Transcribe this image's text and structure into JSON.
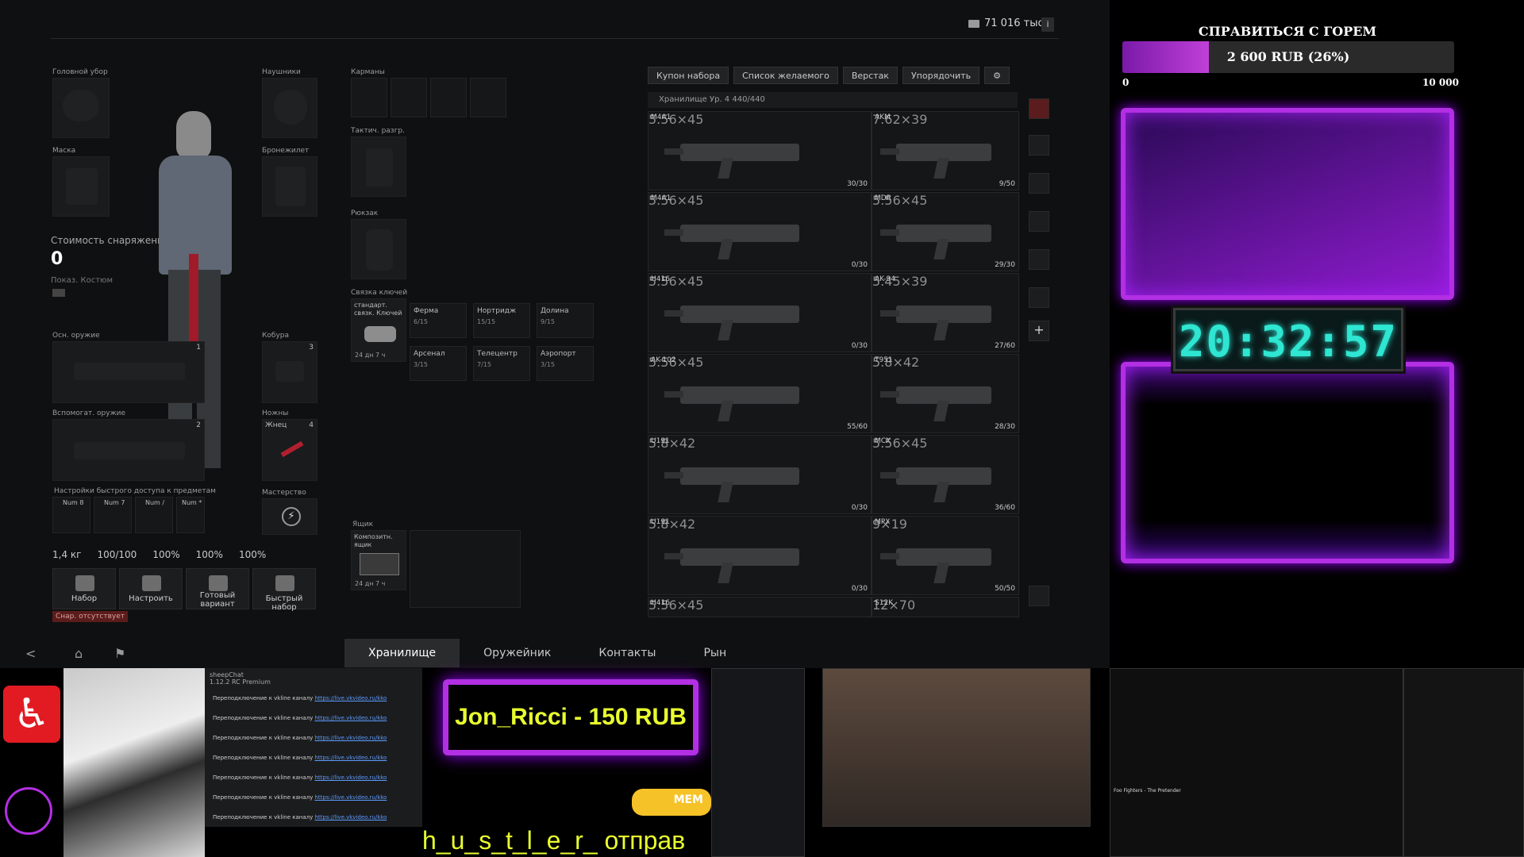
{
  "colors": {
    "accent": "#b22fe3",
    "clock": "#2ee6d2",
    "donation_text": "#e9ff2e",
    "game_bg": "#0f1011"
  },
  "game": {
    "money": "71 016 тыс.",
    "info": "i",
    "slots": {
      "headwear": "Головной убор",
      "headphones": "Наушники",
      "mask": "Маска",
      "armor": "Бронежилет",
      "pockets": "Карманы",
      "rig": "Тактич. разгр.",
      "backpack": "Рюкзак",
      "keychain": "Связка ключей",
      "primary": "Осн. оружие",
      "holster": "Кобура",
      "secondary": "Вспомогат. оружие",
      "knife": "Ножны",
      "knife_item": "Жнец",
      "quickslots": "Настройки быстрого доступа к предметам",
      "mastery": "Мастерство",
      "case": "Ящик",
      "primary_num": "1",
      "holster_num": "3",
      "secondary_num": "2",
      "knife_num": "4"
    },
    "gear_value_label": "Стоимость снаряжения",
    "gear_value": "0",
    "show_costume": "Показ. Костюм",
    "quick_keys": [
      "Num 8",
      "Num 7",
      "Num /",
      "Num *"
    ],
    "keychain_item": {
      "name": "стандарт. связк. Ключей",
      "time": "24 дн 7 ч"
    },
    "key_locations": [
      {
        "name": "Ферма",
        "count": "6/15"
      },
      {
        "name": "Нортридж",
        "count": "15/15"
      },
      {
        "name": "Долина",
        "count": "9/15"
      },
      {
        "name": "Арсенал",
        "count": "3/15"
      },
      {
        "name": "Телецентр",
        "count": "7/15"
      },
      {
        "name": "Аэропорт",
        "count": "3/15"
      }
    ],
    "case_item": {
      "name": "Композитн. ящик",
      "time": "24 дн 7 ч"
    },
    "stats": {
      "weight": "1,4 кг",
      "durability": "100/100",
      "s1": "100%",
      "s2": "100%",
      "s3": "100%"
    },
    "actions": [
      "Набор",
      "Настроить",
      "Готовый вариант",
      "Быстрый набор"
    ],
    "missing_label": "Снар. отсутствует",
    "tabs": [
      "Хранилище",
      "Оружейник",
      "Контакты",
      "Рын"
    ],
    "storage_buttons": [
      "Купон набора",
      "Список желаемого",
      "Верстак",
      "Упорядочить"
    ],
    "storage_title": "Хранилище Ур. 4  440/440",
    "weapons": [
      {
        "name": "M4A1",
        "cal": "5.56×45",
        "count": "30/30"
      },
      {
        "name": "AKM",
        "cal": "7.62×39",
        "count": "9/50"
      },
      {
        "name": "M4A1",
        "cal": "5.56×45",
        "count": "0/30"
      },
      {
        "name": "MDR",
        "cal": "5.56×45",
        "count": "29/30"
      },
      {
        "name": "H416",
        "cal": "5.56×45",
        "count": "0/30"
      },
      {
        "name": "AK-94",
        "cal": "5.45×39",
        "count": "27/60"
      },
      {
        "name": "AK-102",
        "cal": "5.56×45",
        "count": "55/60"
      },
      {
        "name": "T951",
        "cal": "5.8×42",
        "count": "28/30"
      },
      {
        "name": "U191",
        "cal": "5.8×42",
        "count": "0/30"
      },
      {
        "name": "MCX",
        "cal": "5.56×45",
        "count": "36/60"
      },
      {
        "name": "U191",
        "cal": "5.8×42",
        "count": "0/30"
      },
      {
        "name": "MPX",
        "cal": "9×19",
        "count": "50/50"
      },
      {
        "name": "H416",
        "cal": "5.56×45",
        "count": ""
      },
      {
        "name": "S12K",
        "cal": "12×70",
        "count": ""
      }
    ]
  },
  "overlay": {
    "goal_title": "СПРАВИТЬСЯ С ГОРЕМ",
    "goal_text": "2 600 RUB (26%)",
    "goal_progress": 0.26,
    "goal_min": "0",
    "goal_max": "10 000",
    "clock": "20:32:57"
  },
  "bottom": {
    "chat_title": "sheepChat",
    "chat_sub": "1.12.2 RC Premium",
    "chat_lines": [
      {
        "text": "Переподключение к vkline каналу ",
        "link": "https://live.vkvideo.ru/kko"
      },
      {
        "text": "Переподключение к vkline каналу ",
        "link": "https://live.vkvideo.ru/kko"
      },
      {
        "text": "Переподключение к vkline каналу ",
        "link": "https://live.vkvideo.ru/kko"
      },
      {
        "text": "Переподключение к vkline каналу ",
        "link": "https://live.vkvideo.ru/kko"
      },
      {
        "text": "Переподключение к vkline каналу ",
        "link": "https://live.vkvideo.ru/kko"
      },
      {
        "text": "Переподключение к vkline каналу ",
        "link": "https://live.vkvideo.ru/kko"
      },
      {
        "text": "Переподключение к vkline каналу ",
        "link": "https://live.vkvideo.ru/kko"
      }
    ],
    "donation": "Jon_Ricci - 150 RUB",
    "ticker": "h_u_s_t_l_e_r_ отправ",
    "meme": "MEM",
    "video_title": "Foo Fighters - The Pretender"
  }
}
